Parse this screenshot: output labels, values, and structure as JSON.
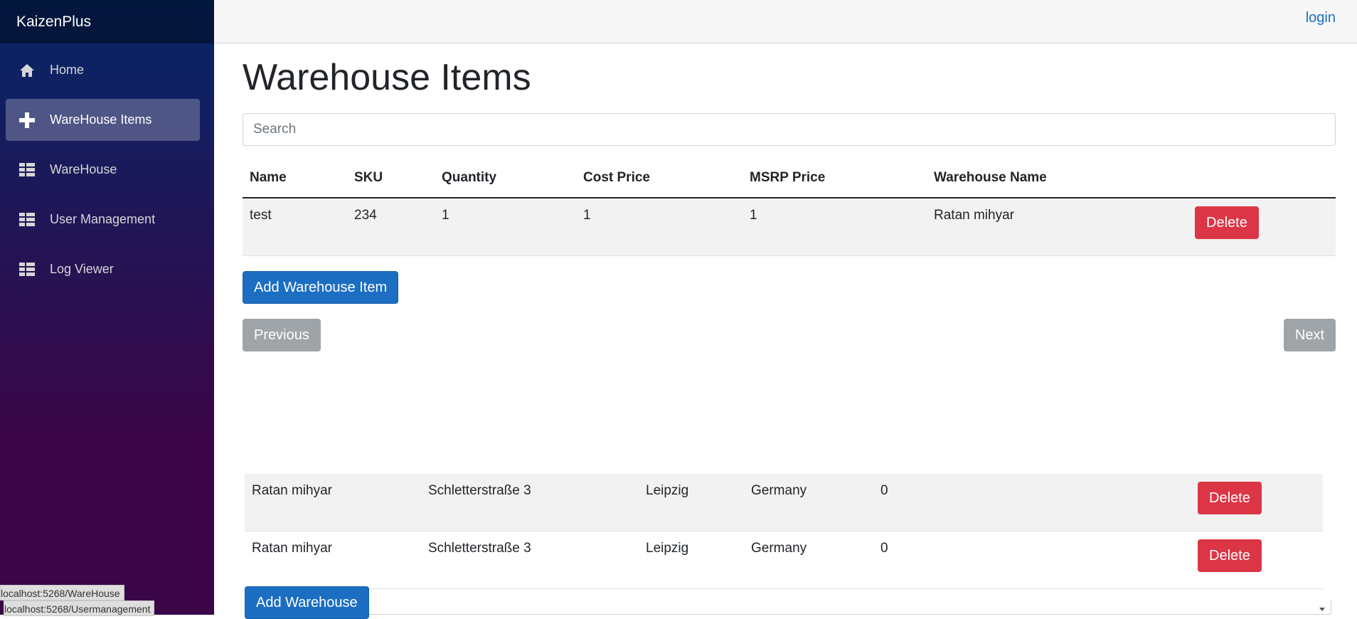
{
  "app": {
    "brand": "KaizenPlus",
    "login": "login"
  },
  "sidebar": {
    "items": [
      {
        "label": "Home",
        "icon": "home-icon"
      },
      {
        "label": "WareHouse Items",
        "icon": "plus-icon",
        "active": true
      },
      {
        "label": "WareHouse",
        "icon": "list-icon"
      },
      {
        "label": "User Management",
        "icon": "list-icon"
      },
      {
        "label": "Log Viewer",
        "icon": "list-icon"
      }
    ]
  },
  "page": {
    "title": "Warehouse Items",
    "search_placeholder": "Search"
  },
  "items_table": {
    "headers": [
      "Name",
      "SKU",
      "Quantity",
      "Cost Price",
      "MSRP Price",
      "Warehouse Name"
    ],
    "rows": [
      {
        "name": "test",
        "sku": "234",
        "quantity": "1",
        "cost": "1",
        "msrp": "1",
        "warehouse": "Ratan mihyar",
        "action": "Delete"
      }
    ]
  },
  "buttons": {
    "add_item": "Add Warehouse Item",
    "previous": "Previous",
    "next": "Next",
    "add_warehouse": "Add Warehouse"
  },
  "warehouse_table": {
    "rows": [
      {
        "name": "Ratan mihyar",
        "street": "Schletterstraße 3",
        "city": "Leipzig",
        "country": "Germany",
        "count": "0",
        "action": "Delete"
      },
      {
        "name": "Ratan mihyar",
        "street": "Schletterstraße 3",
        "city": "Leipzig",
        "country": "Germany",
        "count": "0",
        "action": "Delete"
      }
    ]
  },
  "status_urls": [
    "localhost:5268/WareHouse",
    "localhost:5268/Usermanagement"
  ],
  "colors": {
    "primary": "#1b6ec2",
    "danger": "#dc3545",
    "secondary": "#9fa4a9",
    "sidebar_top": "#052767",
    "sidebar_bottom": "#3a0647"
  }
}
